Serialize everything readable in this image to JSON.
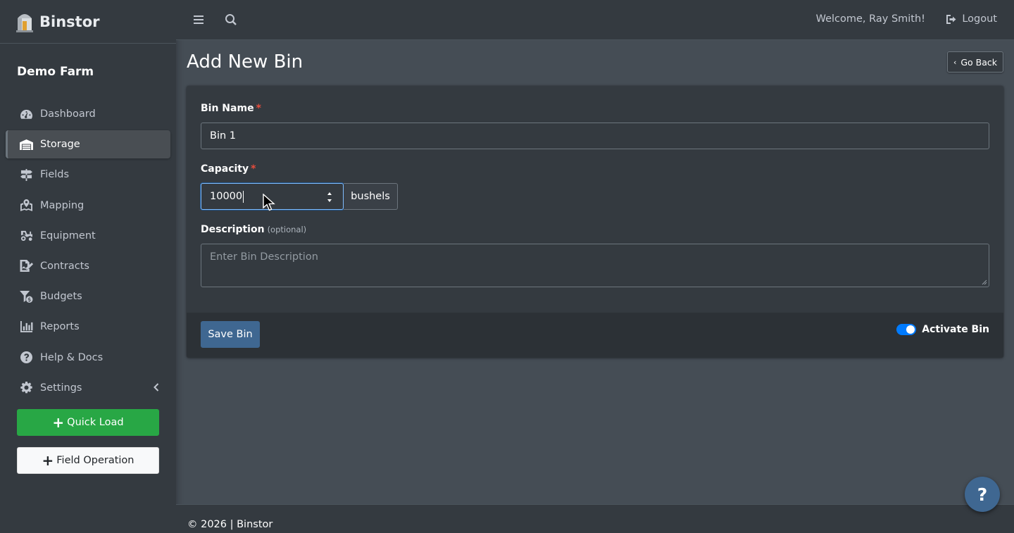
{
  "brand": {
    "name": "Binstor"
  },
  "sidebar": {
    "farm_name": "Demo Farm",
    "items": [
      {
        "label": "Dashboard",
        "icon": "tachometer-icon",
        "active": false
      },
      {
        "label": "Storage",
        "icon": "warehouse-icon",
        "active": true
      },
      {
        "label": "Fields",
        "icon": "signs-icon",
        "active": false
      },
      {
        "label": "Mapping",
        "icon": "map-marked-icon",
        "active": false
      },
      {
        "label": "Equipment",
        "icon": "tractor-icon",
        "active": false
      },
      {
        "label": "Contracts",
        "icon": "file-signature-icon",
        "active": false
      },
      {
        "label": "Budgets",
        "icon": "funnel-dollar-icon",
        "active": false
      },
      {
        "label": "Reports",
        "icon": "chart-bar-icon",
        "active": false
      },
      {
        "label": "Help & Docs",
        "icon": "question-circle-icon",
        "active": false
      },
      {
        "label": "Settings",
        "icon": "gear-icon",
        "active": false
      }
    ],
    "quick_load": "Quick Load",
    "field_operation": "Field Operation"
  },
  "topbar": {
    "welcome": "Welcome, Ray Smith!",
    "logout": "Logout"
  },
  "page": {
    "title": "Add New Bin",
    "go_back": "Go Back"
  },
  "form": {
    "bin_name_label": "Bin Name",
    "bin_name_value": "Bin 1",
    "capacity_label": "Capacity",
    "capacity_value": "10000",
    "capacity_unit": "bushels",
    "description_label": "Description",
    "description_optional": "(optional)",
    "description_placeholder": "Enter Bin Description",
    "required_mark": "*",
    "save_button": "Save Bin",
    "activate_label": "Activate Bin",
    "activate_on": true
  },
  "footer": {
    "text": "© 2026 | Binstor"
  },
  "colors": {
    "accent": "#3f6791",
    "success": "#28a745",
    "toggle": "#007bff",
    "required": "#e74c3c",
    "sidebar_bg": "#343a40",
    "content_bg": "#454d55"
  }
}
